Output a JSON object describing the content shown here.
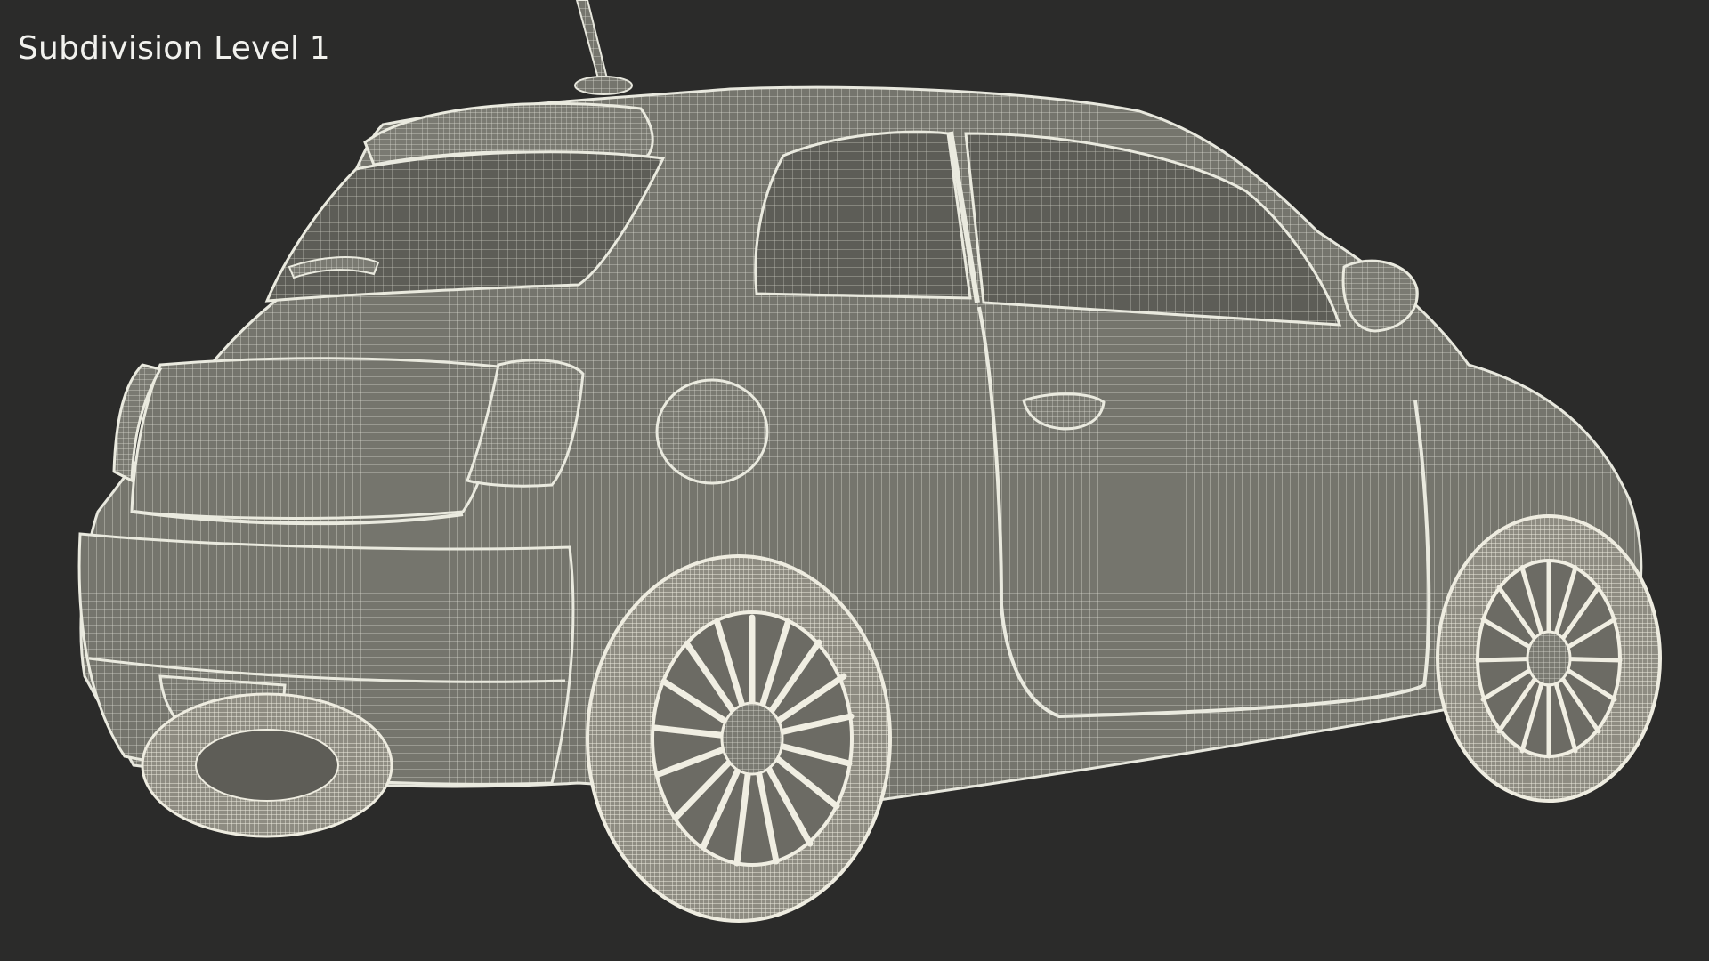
{
  "overlay": {
    "label": "Subdivision Level 1"
  },
  "render": {
    "subject": "wireframe-hatchback-car",
    "background_color": "#2b2b2a",
    "body_color": "#77776f",
    "wire_color": "#e6e6dc",
    "wheel_color": "#eae8dc"
  }
}
